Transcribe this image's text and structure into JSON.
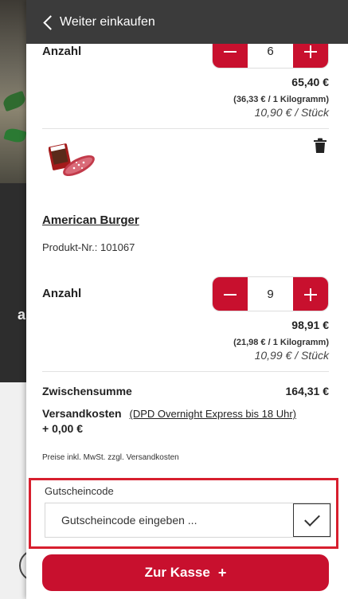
{
  "header": {
    "back_label": "Weiter einkaufen"
  },
  "items": [
    {
      "qty_label": "Anzahl",
      "quantity": "6",
      "price_total": "65,40 €",
      "price_per_kg": "(36,33 € / 1 Kilogramm)",
      "price_per_unit": "10,90 € / Stück"
    },
    {
      "name": "American Burger",
      "product_nr": "Produkt-Nr.: 101067",
      "qty_label": "Anzahl",
      "quantity": "9",
      "price_total": "98,91 €",
      "price_per_kg": "(21,98 € / 1 Kilogramm)",
      "price_per_unit": "10,99 € / Stück"
    }
  ],
  "summary": {
    "subtotal_label": "Zwischensumme",
    "subtotal_value": "164,31 €",
    "shipping_label": "Versandkosten",
    "shipping_method": "(DPD Overnight Express bis 18 Uhr)",
    "shipping_value": "+ 0,00 €",
    "tax_note": "Preise inkl. MwSt. zzgl. Versandkosten"
  },
  "voucher": {
    "label": "Gutscheincode",
    "placeholder": "Gutscheincode eingeben ..."
  },
  "checkout": {
    "label": "Zur Kasse",
    "icon": "+"
  },
  "background": {
    "partial_letter": "a"
  },
  "colors": {
    "brand_red": "#c8102e",
    "header_dark": "#3b3b3b",
    "highlight_red": "#d71f2e"
  }
}
